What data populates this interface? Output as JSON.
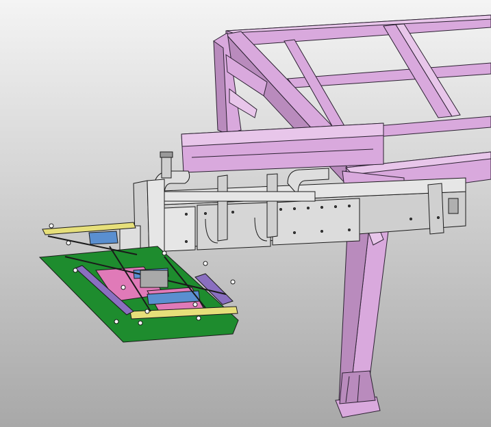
{
  "viewport": {
    "background_top": "#f4f4f4",
    "background_bottom": "#a8a8a8"
  },
  "colors": {
    "frame_fill": "#d9a9dd",
    "frame_dark": "#b98bbd",
    "frame_light": "#e8c6ea",
    "frame_edge": "#2a2030",
    "gantry_fill": "#cfcfcf",
    "gantry_dark": "#a9a9a9",
    "gantry_light": "#e6e6e6",
    "sheet_green": "#1e8c2e",
    "pink_part": "#e07ab8",
    "fixture_yellow": "#e6df7a",
    "fixture_purple": "#8a6fc0",
    "fixture_blue": "#5a8fd0",
    "outline": "#1a1a1a"
  },
  "parts": [
    {
      "icon": "steel-frame-icon"
    },
    {
      "icon": "support-leg-icon"
    },
    {
      "icon": "linear-gantry-icon"
    },
    {
      "icon": "servo-motor-icon"
    },
    {
      "icon": "cable-chain-icon"
    },
    {
      "icon": "gripper-end-effector-icon"
    },
    {
      "icon": "sheet-metal-panel-icon"
    }
  ]
}
